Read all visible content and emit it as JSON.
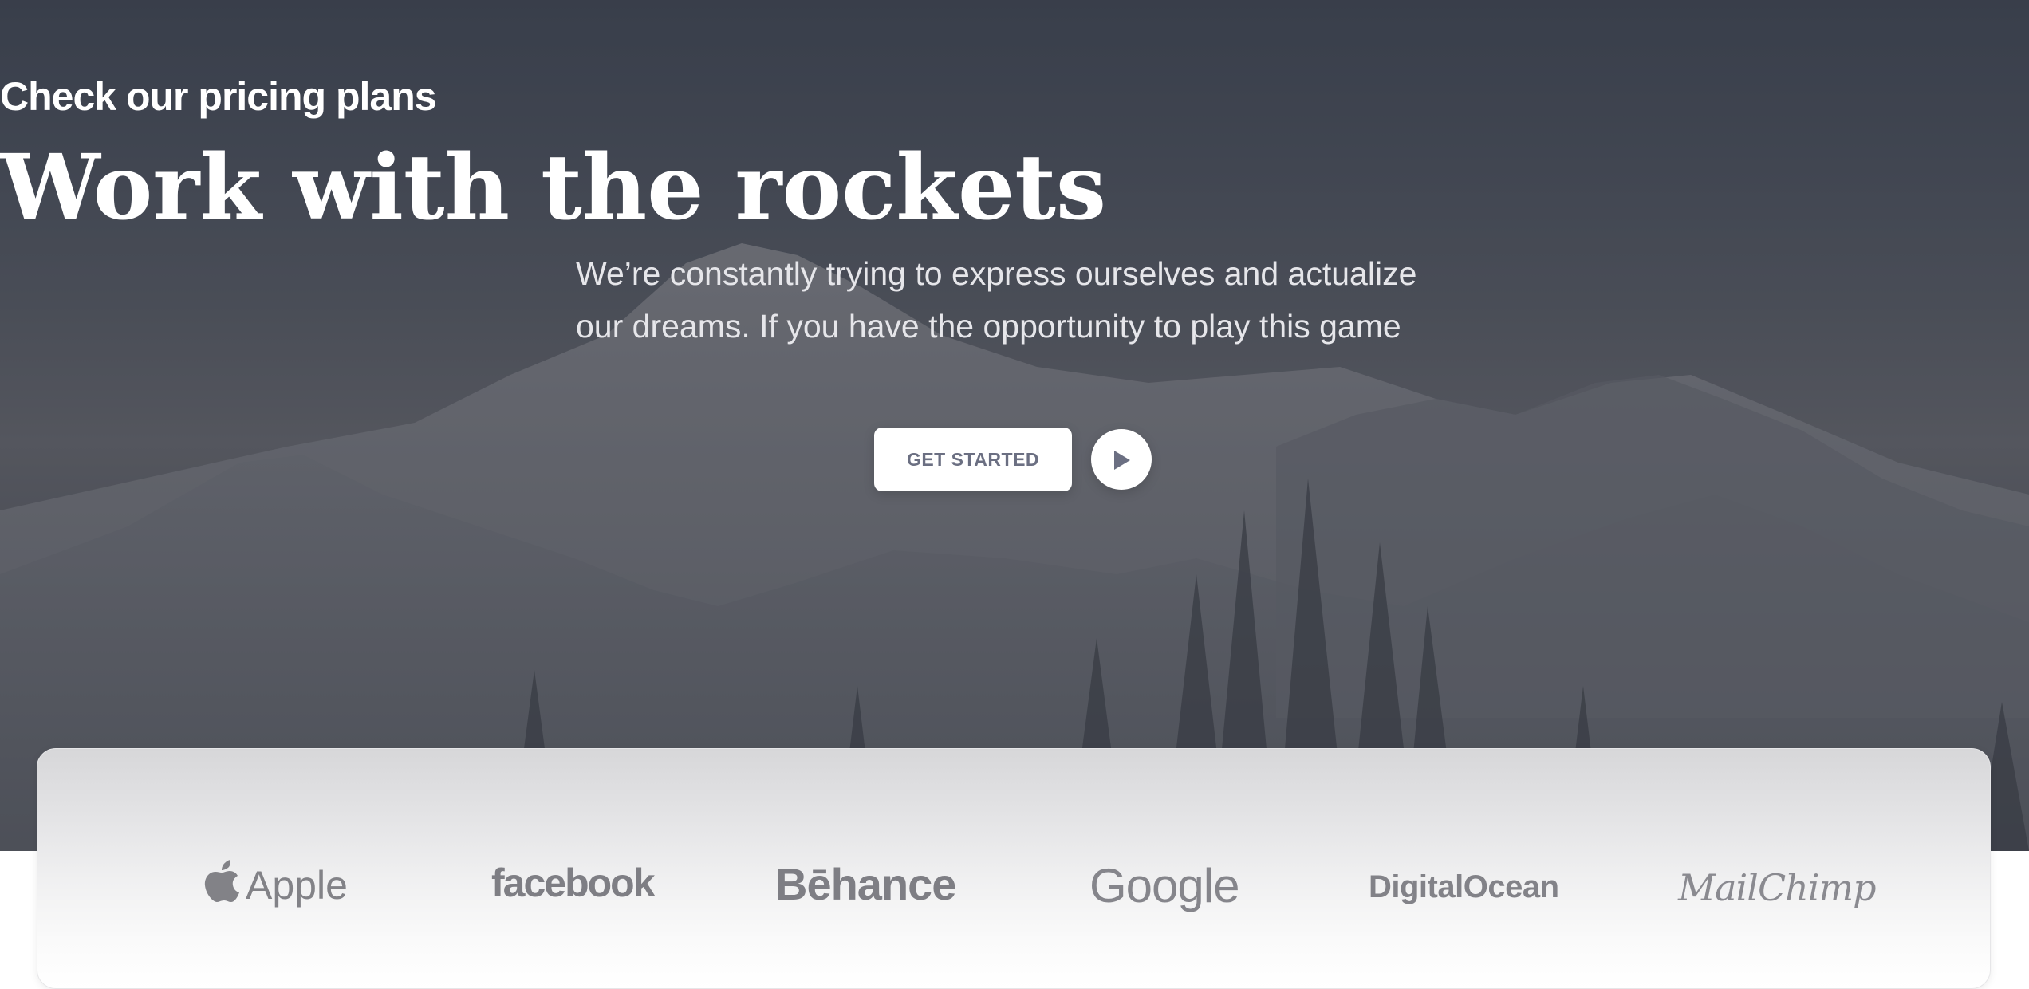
{
  "hero": {
    "subtitle": "Check our pricing plans",
    "title": "Work with the rockets",
    "description": "We’re constantly trying to express ourselves and actualize our dreams. If you have the opportunity to play this game",
    "cta_label": "GET STARTED",
    "play_icon": "play-icon"
  },
  "logos": [
    {
      "name": "Apple",
      "icon": "apple-icon"
    },
    {
      "name": "facebook"
    },
    {
      "name": "Bēhance"
    },
    {
      "name": "Google"
    },
    {
      "name": "DigitalOcean"
    },
    {
      "name": "MailChimp"
    }
  ],
  "colors": {
    "overlay": "#4b505c",
    "button_text": "#6b6f82",
    "logo_gray": "#7e7e84"
  }
}
